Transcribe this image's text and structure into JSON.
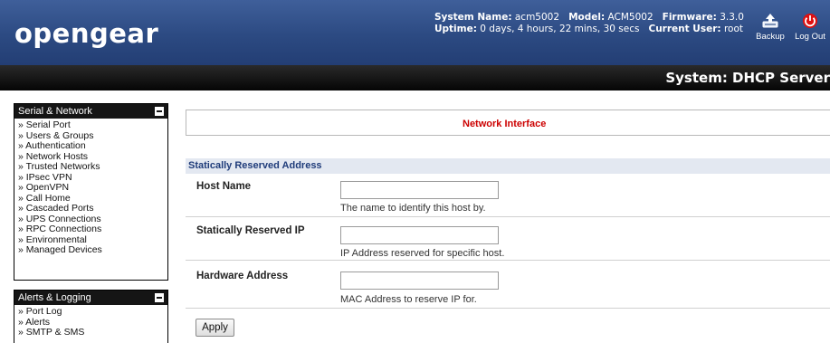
{
  "header": {
    "logo": "opengear",
    "system_name_label": "System Name:",
    "system_name": "acm5002",
    "model_label": "Model:",
    "model": "ACM5002",
    "firmware_label": "Firmware:",
    "firmware": "3.3.0",
    "uptime_label": "Uptime:",
    "uptime": "0 days, 4 hours, 22 mins, 30 secs",
    "current_user_label": "Current User:",
    "current_user": "root",
    "backup_label": "Backup",
    "logout_label": "Log Out",
    "accent_color": "#2c4a82",
    "logout_icon_color": "#e01010"
  },
  "titlebar": {
    "title": "System: DHCP Server"
  },
  "sidebar": {
    "sections": [
      {
        "title": "Serial & Network",
        "items": [
          "» Serial Port",
          "» Users & Groups",
          "» Authentication",
          "» Network Hosts",
          "» Trusted Networks",
          "» IPsec VPN",
          "» OpenVPN",
          "» Call Home",
          "» Cascaded Ports",
          "» UPS Connections",
          "» RPC Connections",
          "» Environmental",
          "» Managed Devices"
        ]
      },
      {
        "title": "Alerts & Logging",
        "items": [
          "» Port Log",
          "» Alerts",
          "» SMTP & SMS"
        ]
      }
    ]
  },
  "main": {
    "network_interface_label": "Network Interface",
    "section_title": "Statically Reserved Address",
    "fields": [
      {
        "label": "Host Name",
        "value": "",
        "help": "The name to identify this host by."
      },
      {
        "label": "Statically Reserved IP",
        "value": "",
        "help": "IP Address reserved for specific host."
      },
      {
        "label": "Hardware Address",
        "value": "",
        "help": "MAC Address to reserve IP for."
      }
    ],
    "apply_label": "Apply"
  }
}
